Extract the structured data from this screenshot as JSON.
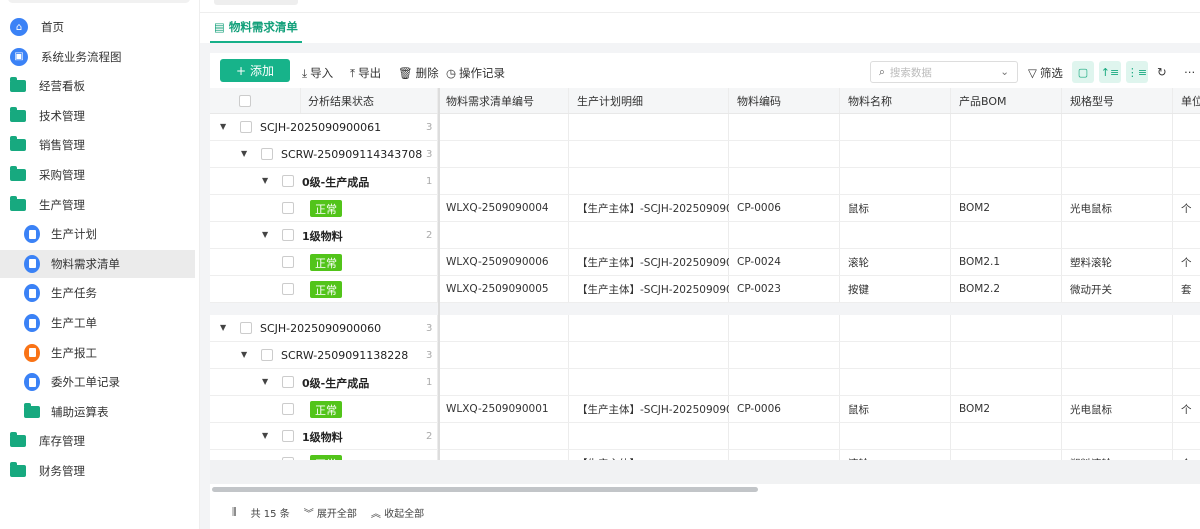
{
  "sidebar": {
    "items": [
      {
        "label": "首页",
        "icon": "home-icon",
        "color": "#3b82f6"
      },
      {
        "label": "系统业务流程图",
        "icon": "box-icon",
        "color": "#3b82f6"
      },
      {
        "label": "经营看板",
        "icon": "folder-icon"
      },
      {
        "label": "技术管理",
        "icon": "folder-icon"
      },
      {
        "label": "销售管理",
        "icon": "folder-icon"
      },
      {
        "label": "采购管理",
        "icon": "folder-icon"
      },
      {
        "label": "生产管理",
        "icon": "folder-icon"
      },
      {
        "label": "生产计划",
        "icon": "doc-icon",
        "sub": true
      },
      {
        "label": "物料需求清单",
        "icon": "doc-icon",
        "sub": true,
        "active": true
      },
      {
        "label": "生产任务",
        "icon": "doc-icon",
        "sub": true
      },
      {
        "label": "生产工单",
        "icon": "doc-icon",
        "sub": true
      },
      {
        "label": "生产报工",
        "icon": "doc-icon",
        "sub": true,
        "color": "#f97316"
      },
      {
        "label": "委外工单记录",
        "icon": "doc-icon",
        "sub": true
      },
      {
        "label": "辅助运算表",
        "icon": "folder-icon",
        "sub": true
      },
      {
        "label": "库存管理",
        "icon": "folder-icon"
      },
      {
        "label": "财务管理",
        "icon": "folder-icon"
      }
    ]
  },
  "tab": {
    "label": "物料需求清单"
  },
  "toolbar": {
    "add": "添加",
    "import": "导入",
    "export": "导出",
    "delete": "删除",
    "log": "操作记录",
    "search_placeholder": "搜索数据",
    "filter": "筛选"
  },
  "columns": [
    "分析结果状态",
    "物料需求清单编号",
    "生产计划明细",
    "物料编码",
    "物料名称",
    "产品BOM",
    "规格型号",
    "单位"
  ],
  "rows": [
    {
      "type": "group",
      "level": 0,
      "label": "SCJH-2025090900061",
      "count": "3"
    },
    {
      "type": "group",
      "level": 1,
      "label": "SCRW-250909114343708",
      "count": "3"
    },
    {
      "type": "group",
      "level": 2,
      "label": "0级-生产成品",
      "count": "1"
    },
    {
      "type": "data",
      "status": "正常",
      "cells": [
        "WLXQ-2509090004",
        "【生产主体】-SCJH-202509090...",
        "CP-0006",
        "鼠标",
        "BOM2",
        "光电鼠标",
        "个"
      ]
    },
    {
      "type": "group",
      "level": 2,
      "label": "1级物料",
      "count": "2"
    },
    {
      "type": "data",
      "status": "正常",
      "cells": [
        "WLXQ-2509090006",
        "【生产主体】-SCJH-202509090...",
        "CP-0024",
        "滚轮",
        "BOM2.1",
        "塑料滚轮",
        "个"
      ]
    },
    {
      "type": "data",
      "status": "正常",
      "cells": [
        "WLXQ-2509090005",
        "【生产主体】-SCJH-202509090...",
        "CP-0023",
        "按键",
        "BOM2.2",
        "微动开关",
        "套"
      ]
    },
    {
      "type": "gap"
    },
    {
      "type": "group",
      "level": 0,
      "label": "SCJH-2025090900060",
      "count": "3"
    },
    {
      "type": "group",
      "level": 1,
      "label": "SCRW-2509091138228",
      "count": "3"
    },
    {
      "type": "group",
      "level": 2,
      "label": "0级-生产成品",
      "count": "1"
    },
    {
      "type": "data",
      "status": "正常",
      "cells": [
        "WLXQ-2509090001",
        "【生产主体】-SCJH-202509090...",
        "CP-0006",
        "鼠标",
        "BOM2",
        "光电鼠标",
        "个"
      ]
    },
    {
      "type": "group",
      "level": 2,
      "label": "1级物料",
      "count": "2"
    },
    {
      "type": "data",
      "status": "正常",
      "cells": [
        "",
        "【生产主体】",
        "",
        "滚轮",
        "",
        "塑料滚轮",
        "个"
      ]
    }
  ],
  "footer": {
    "total": "共 15 条",
    "expand": "展开全部",
    "collapse": "收起全部"
  },
  "colors": {
    "accent": "#17b38a",
    "status_ok": "#52c41a"
  }
}
